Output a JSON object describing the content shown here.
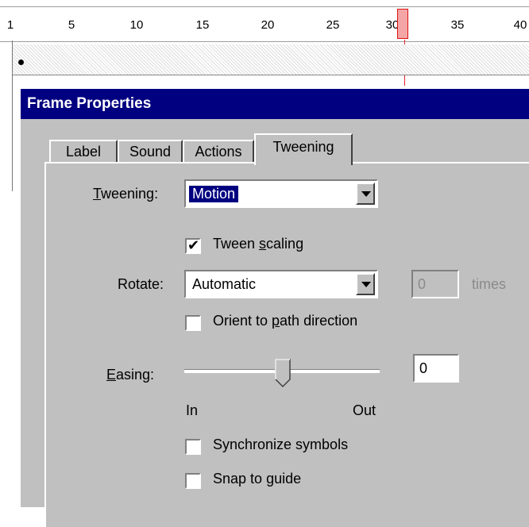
{
  "timeline": {
    "ruler_labels": [
      "1",
      "5",
      "10",
      "15",
      "20",
      "25",
      "30",
      "35",
      "40"
    ],
    "current_frame": 30
  },
  "dialog": {
    "title": "Frame Properties",
    "tabs": [
      {
        "label": "Label"
      },
      {
        "label": "Sound"
      },
      {
        "label": "Actions"
      },
      {
        "label": "Tweening",
        "active": true
      }
    ],
    "tweening": {
      "label": "Tweening:",
      "value": "Motion"
    },
    "tween_scaling": {
      "label": "Tween scaling",
      "checked": true
    },
    "rotate": {
      "label": "Rotate:",
      "value": "Automatic",
      "times_value": "0",
      "times_label": "times"
    },
    "orient_to_path": {
      "label": "Orient to path direction",
      "checked": false
    },
    "easing": {
      "label": "Easing:",
      "value": "0",
      "in_label": "In",
      "out_label": "Out",
      "slider_fraction": 0.5
    },
    "synchronize_symbols": {
      "label": "Synchronize symbols",
      "checked": false
    },
    "snap_to_guide": {
      "label": "Snap to guide",
      "checked": false
    }
  },
  "colors": {
    "title_bar": "#000080",
    "dialog_bg": "#c0c0c0",
    "playhead": "#e2242b"
  }
}
